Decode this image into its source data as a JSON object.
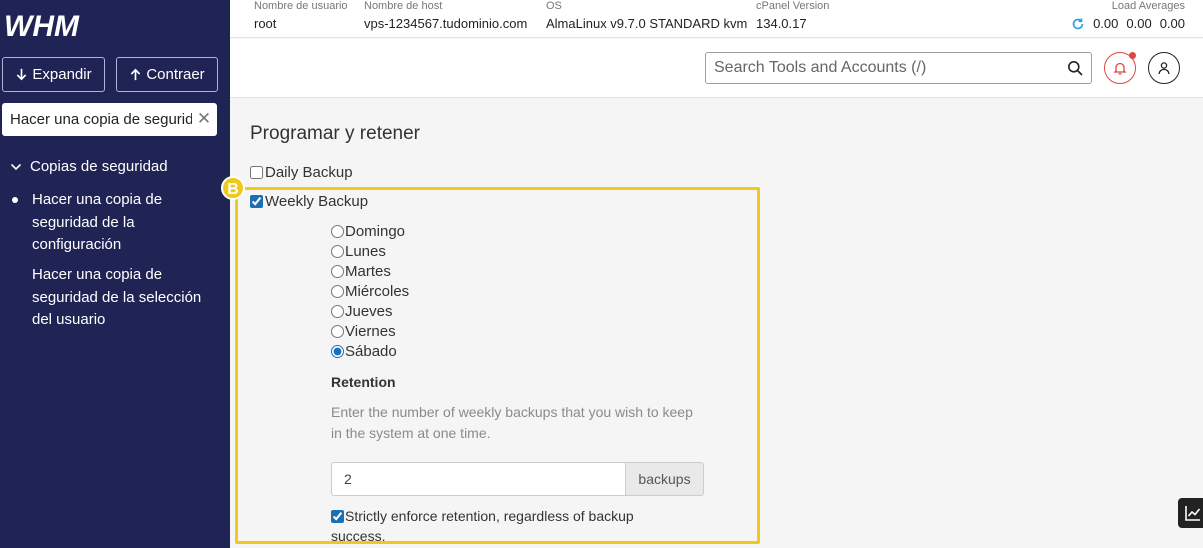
{
  "sidebar": {
    "logo_text": "WHM",
    "expand_label": "Expandir",
    "collapse_label": "Contraer",
    "search_value": "Hacer una copia de seguridad",
    "category": "Copias de seguridad",
    "items": [
      {
        "label": "Hacer una copia de seguridad de la configuración",
        "active": true
      },
      {
        "label": "Hacer una copia de seguridad de la selección del usuario",
        "active": false
      }
    ]
  },
  "topbar": {
    "username_label": "Nombre de usuario",
    "username": "root",
    "hostname_label": "Nombre de host",
    "hostname": "vps-1234567.tudominio.com",
    "os_label": "OS",
    "os": "AlmaLinux v9.7.0 STANDARD kvm",
    "version_label": "cPanel Version",
    "version": "134.0.17",
    "load_label": "Load Averages",
    "load_1": "0.00",
    "load_2": "0.00",
    "load_3": "0.00"
  },
  "header": {
    "search_placeholder": "Search Tools and Accounts (/)"
  },
  "main": {
    "section_title": "Programar y retener",
    "marker": "B",
    "daily_label": "Daily Backup",
    "daily_checked": false,
    "weekly_label": "Weekly Backup",
    "weekly_checked": true,
    "days": [
      "Domingo",
      "Lunes",
      "Martes",
      "Miércoles",
      "Jueves",
      "Viernes",
      "Sábado"
    ],
    "selected_day": "Sábado",
    "retention_title": "Retention",
    "retention_help": "Enter the number of weekly backups that you wish to keep in the system at one time.",
    "retention_value": "2",
    "retention_unit": "backups",
    "strict_label": "Strictly enforce retention, regardless of backup success.",
    "strict_checked": true
  },
  "colors": {
    "sidebar_bg": "#1f2455",
    "highlight": "#f0c91c",
    "alert": "#e0453f",
    "accent": "#1a6fb6"
  }
}
